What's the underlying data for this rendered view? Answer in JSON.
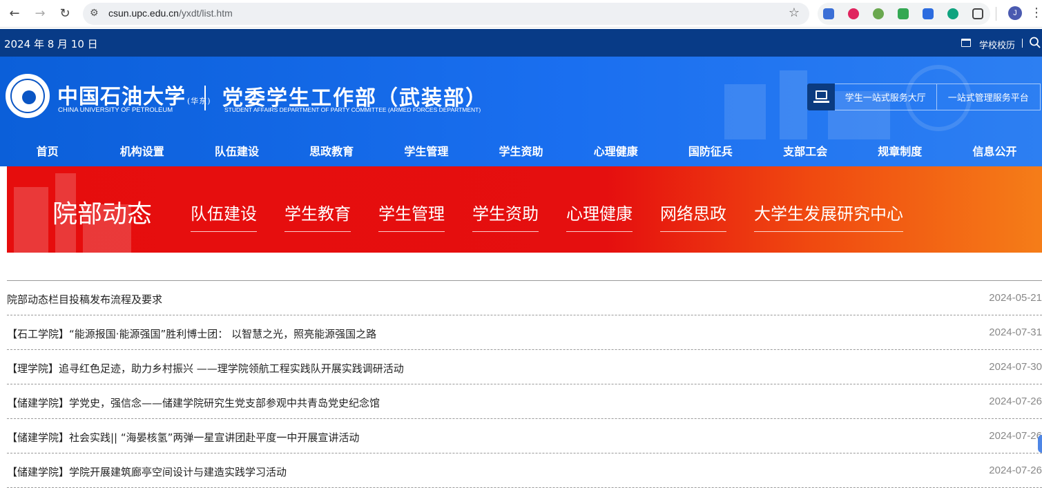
{
  "browser": {
    "url_host": "csun.upc.edu.cn",
    "url_path": "/yxdt/list.htm",
    "profile_initial": "J"
  },
  "topbar": {
    "date": "2024 年 8 月 10 日",
    "history_link": "学校校历"
  },
  "header": {
    "university_cn": "中国石油大学",
    "university_suffix": "(华东)",
    "university_en": "CHINA UNIVERSITY OF PETROLEUM",
    "department_cn": "党委学生工作部（武装部）",
    "department_en": "STUDENT AFFAIRS DEPARTMENT OF PARTY COMMITTEE (ARMED FORCES DEPARTMENT)",
    "service_buttons": [
      "学生一站式服务大厅",
      "一站式管理服务平台"
    ]
  },
  "main_nav": [
    "首页",
    "机构设置",
    "队伍建设",
    "思政教育",
    "学生管理",
    "学生资助",
    "心理健康",
    "国防征兵",
    "支部工会",
    "规章制度",
    "信息公开"
  ],
  "banner": {
    "title": "院部动态",
    "sub_nav": [
      "队伍建设",
      "学生教育",
      "学生管理",
      "学生资助",
      "心理健康",
      "网络思政",
      "大学生发展研究中心"
    ]
  },
  "news": [
    {
      "title": "院部动态栏目投稿发布流程及要求",
      "date": "2024-05-21"
    },
    {
      "title": "【石工学院】“能源报国·能源强国”胜利博士团： 以智慧之光，照亮能源强国之路",
      "date": "2024-07-31"
    },
    {
      "title": "【理学院】追寻红色足迹，助力乡村振兴 ——理学院领航工程实践队开展实践调研活动",
      "date": "2024-07-30"
    },
    {
      "title": "【储建学院】学党史，强信念——储建学院研究生党支部参观中共青岛党史纪念馆",
      "date": "2024-07-26"
    },
    {
      "title": "【储建学院】社会实践|| “海晏核氢”两弹一星宣讲团赴平度一中开展宣讲活动",
      "date": "2024-07-26"
    },
    {
      "title": "【储建学院】学院开展建筑廊亭空间设计与建造实践学习活动",
      "date": "2024-07-26"
    }
  ],
  "colors": {
    "topbar": "#083b87",
    "header": "#1a6ff0",
    "banner_red": "#e60d0d",
    "banner_orange": "#f57d18"
  }
}
